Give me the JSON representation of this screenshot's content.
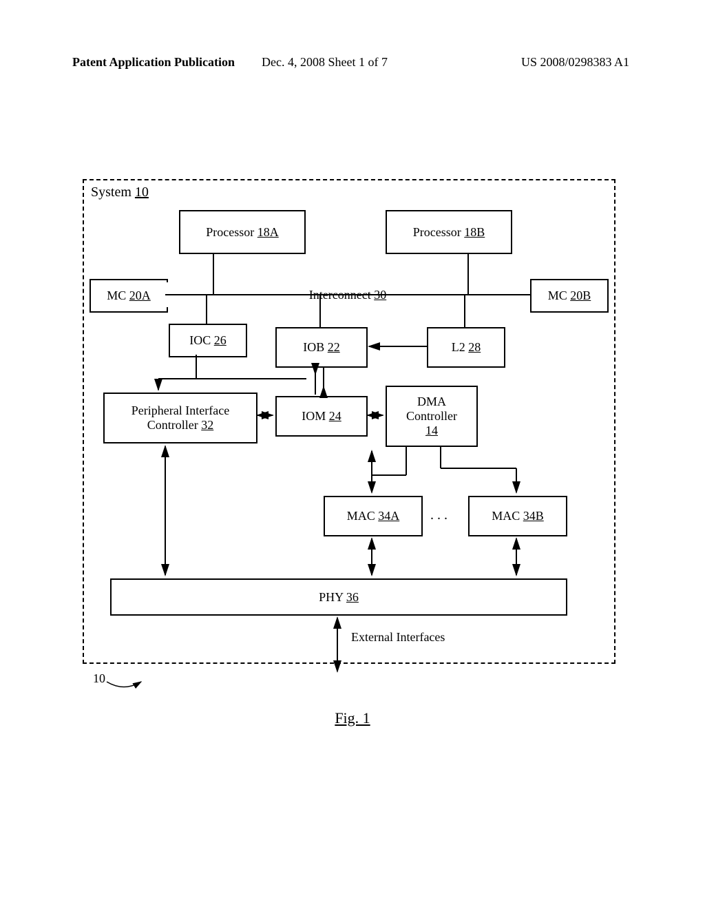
{
  "header": {
    "left": "Patent Application Publication",
    "center": "Dec. 4, 2008  Sheet 1 of 7",
    "right": "US 2008/0298383 A1"
  },
  "system_label": "System",
  "system_ref": "10",
  "blocks": {
    "proc_a": {
      "name": "Processor",
      "ref": "18A"
    },
    "proc_b": {
      "name": "Processor",
      "ref": "18B"
    },
    "mc_a": {
      "name": "MC",
      "ref": "20A"
    },
    "mc_b": {
      "name": "MC",
      "ref": "20B"
    },
    "interconnect": {
      "name": "Interconnect",
      "ref": "30"
    },
    "ioc": {
      "name": "IOC",
      "ref": "26"
    },
    "iob": {
      "name": "IOB",
      "ref": "22"
    },
    "l2": {
      "name": "L2",
      "ref": "28"
    },
    "pic": {
      "line1": "Peripheral Interface",
      "line2": "Controller",
      "ref": "32"
    },
    "iom": {
      "name": "IOM",
      "ref": "24"
    },
    "dma": {
      "line1": "DMA",
      "line2": "Controller",
      "ref": "14"
    },
    "mac_a": {
      "name": "MAC",
      "ref": "34A"
    },
    "mac_b": {
      "name": "MAC",
      "ref": "34B"
    },
    "phy": {
      "name": "PHY",
      "ref": "36"
    }
  },
  "ellipsis": ". . .",
  "external_label": "External Interfaces",
  "ref_callout": "10",
  "figure_caption": "Fig. 1"
}
